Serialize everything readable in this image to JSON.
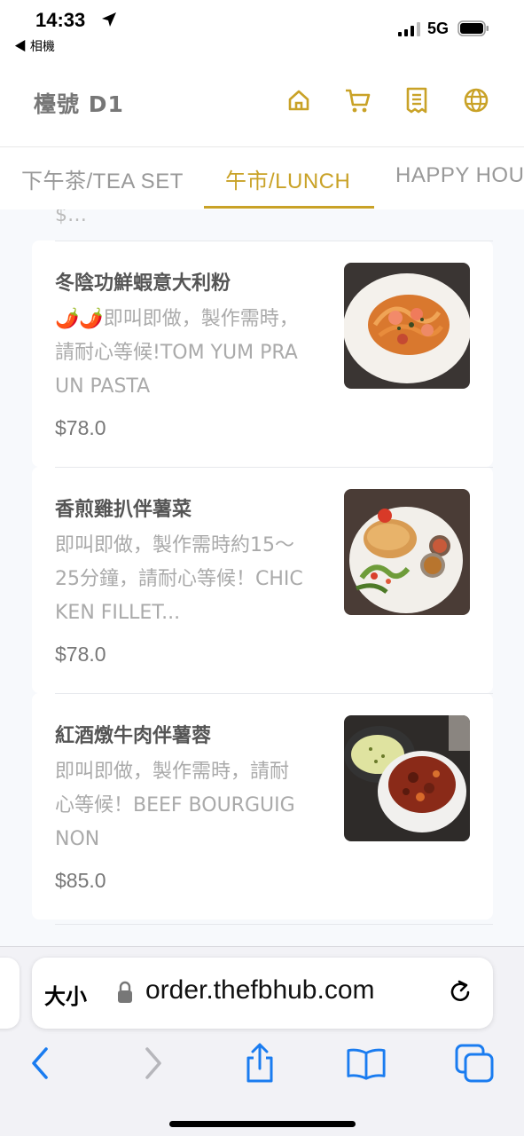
{
  "status_bar": {
    "time": "14:33",
    "back_label": "◀ 相機",
    "network": "5G"
  },
  "header": {
    "title": "檯號 D1",
    "icons": [
      "home-icon",
      "cart-icon",
      "receipt-icon",
      "globe-icon"
    ],
    "accent_color": "#c9a227"
  },
  "tabs": [
    {
      "label": "下午茶/TEA SET",
      "active": false
    },
    {
      "label": "午市/LUNCH",
      "active": true
    },
    {
      "label": "HAPPY HOU",
      "active": false
    }
  ],
  "menu": {
    "cut_off_top_text": "$…",
    "items": [
      {
        "name": "冬陰功鮮蝦意大利粉",
        "description": "🌶️🌶️即叫即做，製作需時，請耐心等候!TOM YUM PRAUN PASTA",
        "price": "$78.0",
        "image": "pasta-photo"
      },
      {
        "name": "香煎雞扒伴薯菜",
        "description": "即叫即做，製作需時約15～25分鐘，請耐心等候！CHICKEN FILLET...",
        "price": "$78.0",
        "image": "chicken-photo"
      },
      {
        "name": "紅酒燉牛肉伴薯蓉",
        "description": "即叫即做，製作需時，請耐心等候！BEEF BOURGUIGNON",
        "price": "$85.0",
        "image": "beef-photo"
      }
    ]
  },
  "safari": {
    "text_size_label": "大小",
    "url": "order.thefbhub.com",
    "toolbar_icons": [
      "back-icon",
      "forward-icon",
      "share-icon",
      "bookmarks-icon",
      "tabs-icon"
    ],
    "toolbar_color": "#1a7cf0"
  }
}
